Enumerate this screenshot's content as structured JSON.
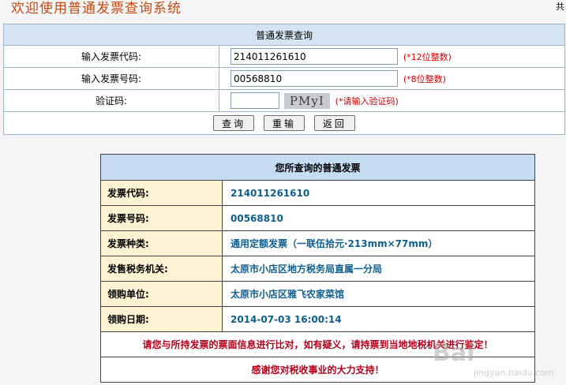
{
  "header": {
    "title": "欢迎使用普通发票查询系统",
    "corner": "共"
  },
  "form": {
    "title": "普通发票查询",
    "code_label": "输入发票代码:",
    "code_value": "214011261610",
    "code_hint": "(*12位整数)",
    "number_label": "输入发票号码:",
    "number_value": "00568810",
    "number_hint": "(*8位整数)",
    "captcha_label": "验证码:",
    "captcha_value": "",
    "captcha_image_text": "PMyI",
    "captcha_hint": "(*请输入验证码)",
    "buttons": {
      "query": "查询",
      "reset": "重输",
      "back": "返回"
    }
  },
  "result": {
    "title": "您所查询的普通发票",
    "rows": [
      {
        "label": "发票代码:",
        "value": "214011261610"
      },
      {
        "label": "发票号码:",
        "value": "00568810"
      },
      {
        "label": "发票种类:",
        "value": "通用定额发票（一联伍拾元·213mm×77mm）"
      },
      {
        "label": "发售税务机关:",
        "value": "太原市小店区地方税务局直属一分局"
      },
      {
        "label": "领购单位:",
        "value": "太原市小店区雅飞农家菜馆"
      },
      {
        "label": "领购日期:",
        "value": "2014-07-03 16:00:14"
      }
    ],
    "notice": "请您与所持发票的票面信息进行比对，如有疑义，请持票到当地地税机关进行鉴定！",
    "thanks": "感谢您对税收事业的大力支持！"
  },
  "watermark": {
    "brand": "Bai",
    "sub": "jingyan.baidu.com"
  }
}
